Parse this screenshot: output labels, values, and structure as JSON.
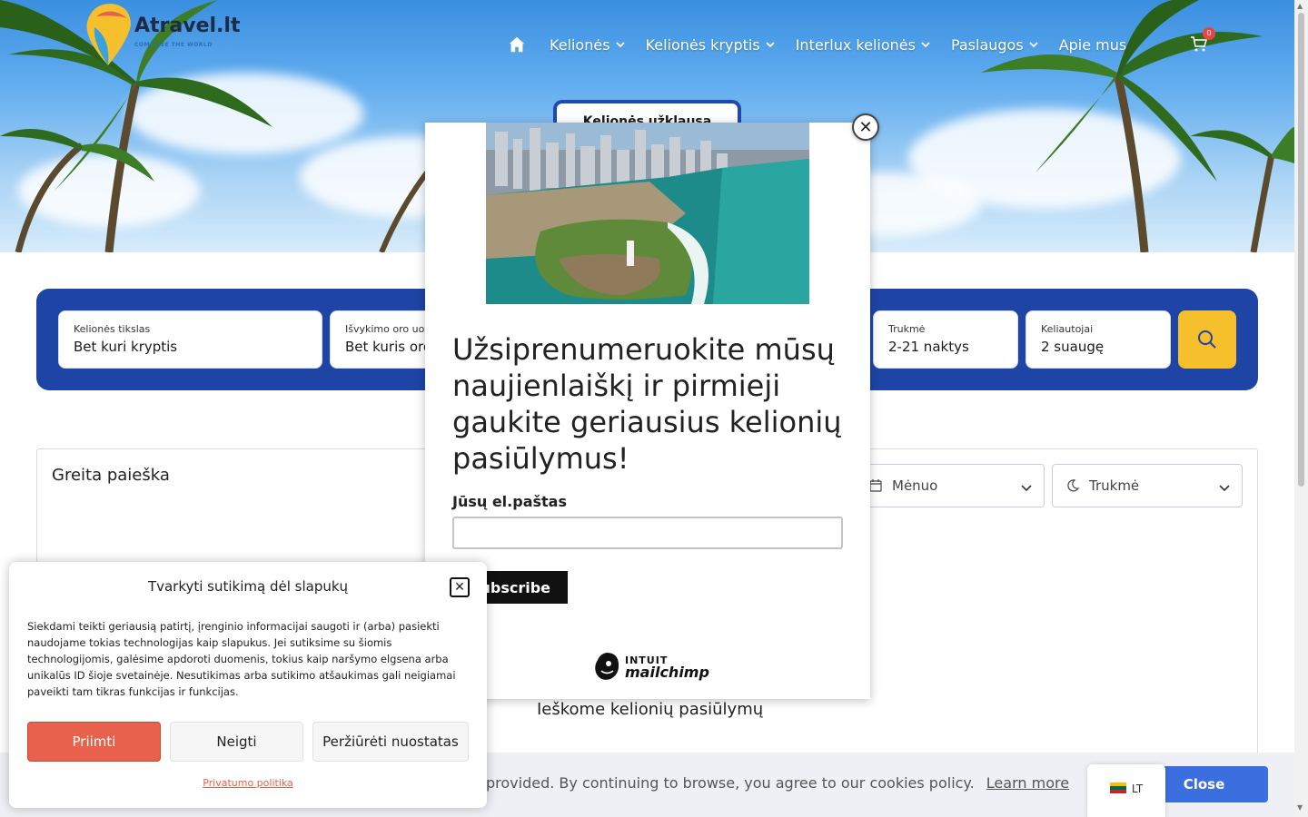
{
  "header": {
    "logo_title": "Atravel.lt",
    "logo_subtitle": "COME SEE THE WORLD",
    "nav": [
      {
        "label": "Kelionės"
      },
      {
        "label": "Kelionės kryptis"
      },
      {
        "label": "Interlux kelionės"
      },
      {
        "label": "Paslaugos"
      },
      {
        "label": "Apie mus"
      }
    ],
    "cart_count": "0",
    "inquiry_tab": "Kelionės užklausa"
  },
  "search": {
    "fields": [
      {
        "label": "Kelionės tikslas",
        "value": "Bet kuri kryptis"
      },
      {
        "label": "Išvykimo oro uostas",
        "value": "Bet kuris oro uostas"
      },
      {
        "label": "Trukmė",
        "value": "2-21 naktys"
      },
      {
        "label": "Keliautojai",
        "value": "2 suaugę"
      }
    ]
  },
  "quick_search": {
    "title": "Greita paieška",
    "month_placeholder": "Mėnuo",
    "duration_placeholder": "Trukmė",
    "loading_text": "Ieškome kelionių pasiūlymų"
  },
  "newsletter": {
    "heading": "Užsiprenumeruokite mūsų naujienlaiškį ir pirmieji gaukite geriausius kelionių pasiūlymus!",
    "email_label": "Jūsų el.paštas",
    "subscribe_label": "Subscribe",
    "brand_top": "INTUIT",
    "brand_name": "mailchimp"
  },
  "consent": {
    "title": "Tvarkyti sutikimą dėl slapukų",
    "body": "Siekdami teikti geriausią patirtį, įrenginio informacijai saugoti ir (arba) pasiekti naudojame tokias technologijas kaip slapukus. Jei sutiksime su šiomis technologijomis, galėsime apdoroti duomenis, tokius kaip naršymo elgsena arba unikalūs ID šioje svetainėje. Nesutikimas arba sutikimo atšaukimas gali neigiamai paveikti tam tikras funkcijas ir funkcijas.",
    "accept": "Priimti",
    "deny": "Neigti",
    "preferences": "Peržiūrėti nuostatas",
    "privacy": "Privatumo politika"
  },
  "cookie_bar": {
    "text": "provided. By continuing to browse, you agree to our cookies policy.",
    "learn_more": "Learn more",
    "close": "Close"
  },
  "language": {
    "code": "LT"
  },
  "colors": {
    "primary": "#1e45a6",
    "accent": "#f5c02c",
    "accept": "#e8614d",
    "close_button": "#3b6fe0"
  }
}
